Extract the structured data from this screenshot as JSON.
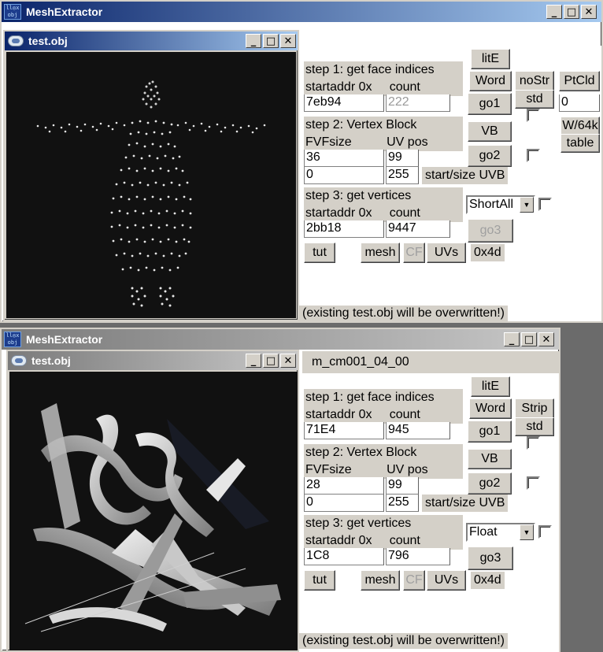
{
  "app_title": "MeshExtractor",
  "child_title": "test.obj",
  "icon_text": "ll◎x\nobj",
  "controls": {
    "min": "_",
    "max": "□",
    "close": "✕"
  },
  "windows": [
    {
      "tab_label": "",
      "step1": {
        "header": "step 1: get face indices",
        "sub": "startaddr 0x     count",
        "addr": "7eb94",
        "count": "222",
        "count_disabled": true
      },
      "step2": {
        "header": "step 2: Vertex Block",
        "sub": "FVFsize          UV pos",
        "fvf": "36",
        "uvpos": "99",
        "start": "0",
        "size": "255",
        "uvb_label": "start/size UVB"
      },
      "step3": {
        "header": "step 3: get vertices",
        "sub": "startaddr 0x     count",
        "addr": "2bb18",
        "count": "9447",
        "format": "ShortAll"
      },
      "buttons": {
        "lite": "litE",
        "word": "Word",
        "go1": "go1",
        "vb": "VB",
        "go2": "go2",
        "go3": "go3",
        "tut": "tut",
        "mesh": "mesh",
        "cf": "CF",
        "uvs": "UVs"
      },
      "strip_label": "noStr",
      "std_label": "std",
      "ptcld_label": "PtCld",
      "ptcld_value": "0",
      "w64k_label": "W/64k",
      "table_label": "table",
      "hex_label": "0x4d",
      "warning": "(existing test.obj will be overwritten!)"
    },
    {
      "tab_label": "m_cm001_04_00",
      "step1": {
        "header": "step 1: get face indices",
        "sub": "startaddr 0x     count",
        "addr": "71E4",
        "count": "945",
        "count_disabled": false
      },
      "step2": {
        "header": "step 2: Vertex Block",
        "sub": "FVFsize          UV pos",
        "fvf": "28",
        "uvpos": "99",
        "start": "0",
        "size": "255",
        "uvb_label": "start/size UVB"
      },
      "step3": {
        "header": "step 3: get vertices",
        "sub": "startaddr 0x     count",
        "addr": "1C8",
        "count": "796",
        "format": "Float"
      },
      "buttons": {
        "lite": "litE",
        "word": "Word",
        "go1": "go1",
        "vb": "VB",
        "go2": "go2",
        "go3": "go3",
        "tut": "tut",
        "mesh": "mesh",
        "cf": "CF",
        "uvs": "UVs"
      },
      "strip_label": "Strip",
      "std_label": "std",
      "hex_label": "0x4d",
      "warning": "(existing test.obj will be overwritten!)"
    }
  ],
  "colors": {
    "face": "#d4d0c8",
    "titlebar_active": "#0a246a",
    "viewport": "#111111"
  }
}
